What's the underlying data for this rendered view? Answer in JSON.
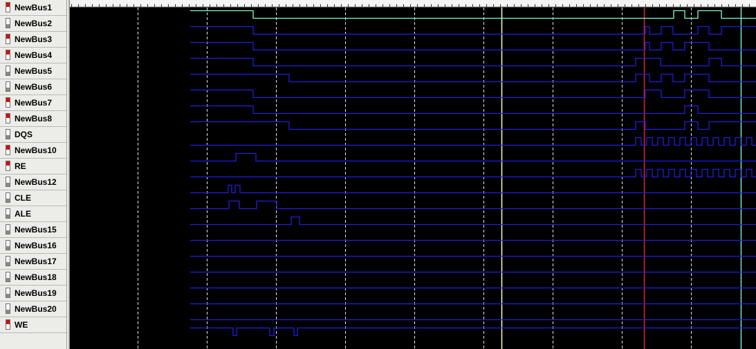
{
  "signals": [
    {
      "name": "NewBus1",
      "indicator": "red"
    },
    {
      "name": "NewBus2",
      "indicator": "gray"
    },
    {
      "name": "NewBus3",
      "indicator": "red"
    },
    {
      "name": "NewBus4",
      "indicator": "red"
    },
    {
      "name": "NewBus5",
      "indicator": "gray"
    },
    {
      "name": "NewBus6",
      "indicator": "gray"
    },
    {
      "name": "NewBus7",
      "indicator": "red"
    },
    {
      "name": "NewBus8",
      "indicator": "red"
    },
    {
      "name": "DQS",
      "indicator": "gray"
    },
    {
      "name": "NewBus10",
      "indicator": "red"
    },
    {
      "name": "RE",
      "indicator": "red"
    },
    {
      "name": "NewBus12",
      "indicator": "gray"
    },
    {
      "name": "CLE",
      "indicator": "gray"
    },
    {
      "name": "ALE",
      "indicator": "gray"
    },
    {
      "name": "NewBus15",
      "indicator": "gray"
    },
    {
      "name": "NewBus16",
      "indicator": "gray"
    },
    {
      "name": "NewBus17",
      "indicator": "gray"
    },
    {
      "name": "NewBus18",
      "indicator": "gray"
    },
    {
      "name": "NewBus19",
      "indicator": "gray"
    },
    {
      "name": "NewBus20",
      "indicator": "gray"
    },
    {
      "name": "WE",
      "indicator": "red"
    }
  ],
  "colors": {
    "trace": "#2020e0",
    "selected_trace": "#7fffd4",
    "background": "#000000",
    "grid": "#ffffff",
    "cursor_a": "#ffffc0",
    "cursor_b": "#e02030",
    "cursor_c": "#7fe0e0",
    "indicator_red": "#d01010",
    "indicator_gray": "#8a8a8a"
  }
}
